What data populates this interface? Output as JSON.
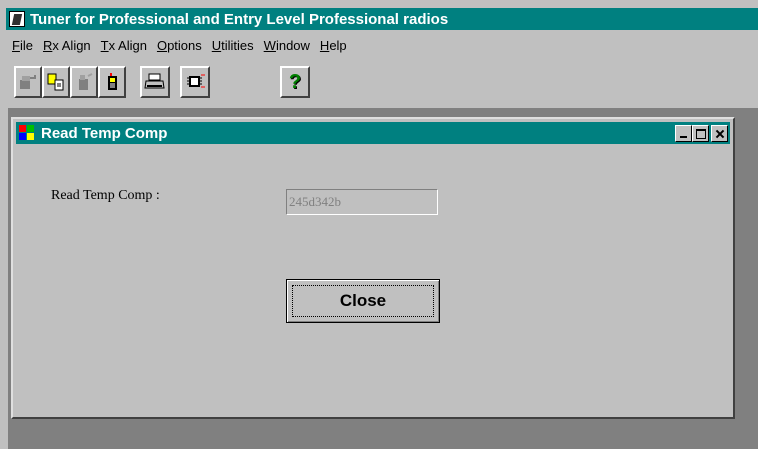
{
  "app": {
    "title": "Tuner for Professional and Entry Level Professional radios"
  },
  "menu": [
    {
      "label": "File"
    },
    {
      "label": "Rx Align"
    },
    {
      "label": "Tx Align"
    },
    {
      "label": "Options"
    },
    {
      "label": "Utilities"
    },
    {
      "label": "Window"
    },
    {
      "label": "Help"
    }
  ],
  "toolbar": {
    "help_glyph": "?"
  },
  "child_window": {
    "title": "Read Temp Comp",
    "field_label": "Read Temp Comp  :",
    "field_value": "245d342b",
    "close_label": "Close"
  },
  "colors": {
    "titlebar": "#008080",
    "face": "#c0c0c0",
    "workspace": "#808080"
  }
}
